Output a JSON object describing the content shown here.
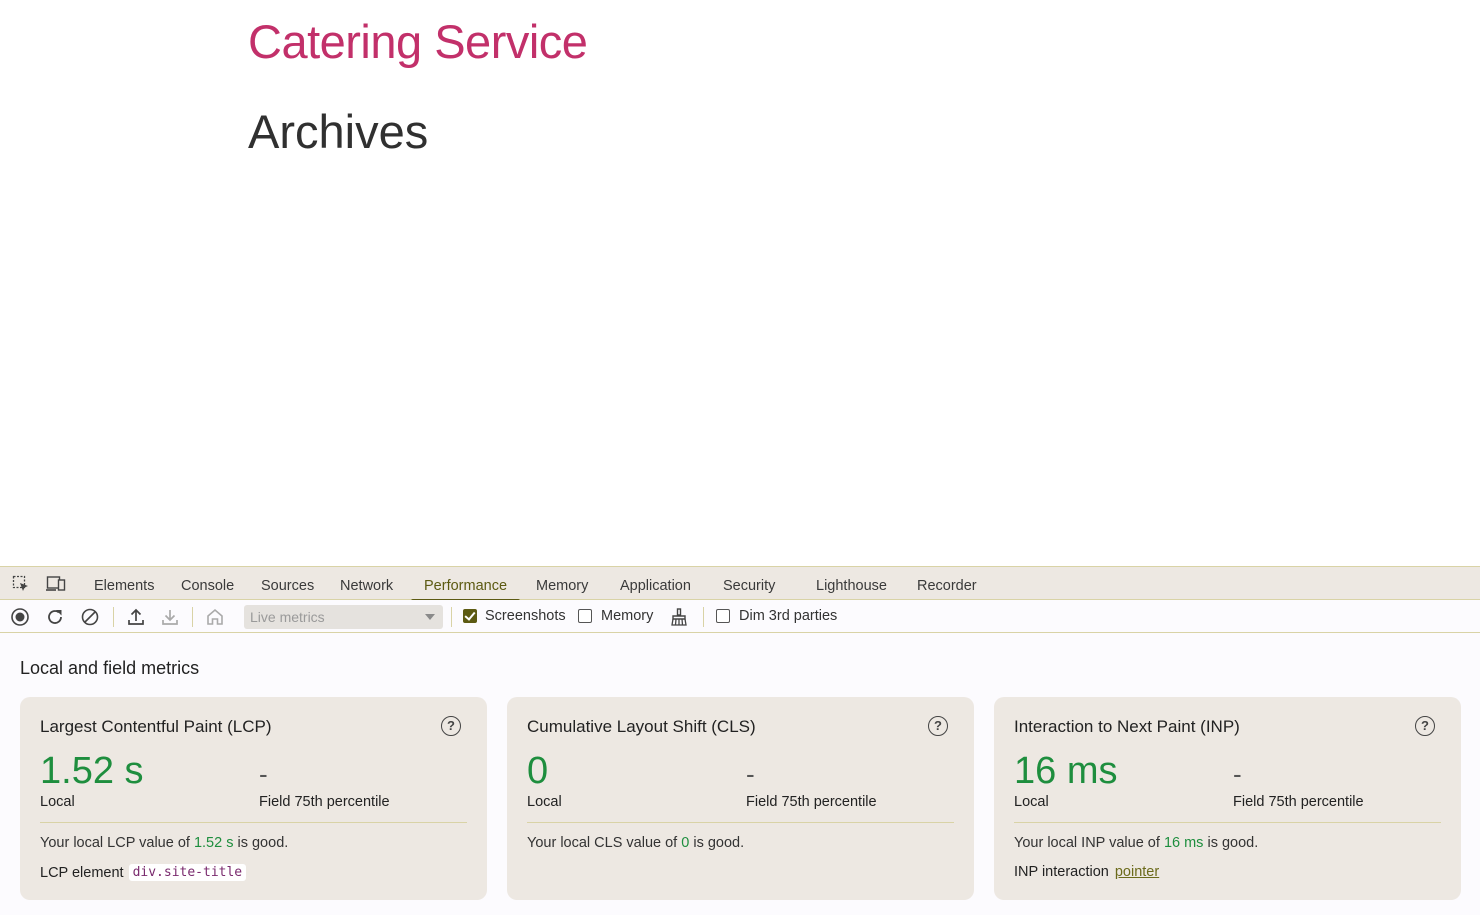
{
  "page": {
    "site_title": "Catering Service",
    "heading": "Archives"
  },
  "devtools": {
    "tabs": [
      "Elements",
      "Console",
      "Sources",
      "Network",
      "Performance",
      "Memory",
      "Application",
      "Security",
      "Lighthouse",
      "Recorder"
    ],
    "active_tab": "Performance",
    "toolbar": {
      "select_value": "Live metrics",
      "screenshots_label": "Screenshots",
      "screenshots_checked": true,
      "memory_label": "Memory",
      "memory_checked": false,
      "dim_label": "Dim 3rd parties",
      "dim_checked": false
    },
    "section_title": "Local and field metrics",
    "colors": {
      "accent": "#5c5a12",
      "good": "#1e8e3e",
      "site_title": "#c2306a"
    },
    "cards": [
      {
        "title": "Largest Contentful Paint (LCP)",
        "value": "1.52 s",
        "field_value": "-",
        "local_label": "Local",
        "field_label": "Field 75th percentile",
        "desc_prefix": "Your local LCP value of ",
        "desc_value": "1.52 s",
        "desc_suffix": " is good.",
        "extra_label": "LCP element",
        "extra_value": "div.site-title"
      },
      {
        "title": "Cumulative Layout Shift (CLS)",
        "value": "0",
        "field_value": "-",
        "local_label": "Local",
        "field_label": "Field 75th percentile",
        "desc_prefix": "Your local CLS value of ",
        "desc_value": "0",
        "desc_suffix": " is good."
      },
      {
        "title": "Interaction to Next Paint (INP)",
        "value": "16 ms",
        "field_value": "-",
        "local_label": "Local",
        "field_label": "Field 75th percentile",
        "desc_prefix": "Your local INP value of ",
        "desc_value": "16 ms",
        "desc_suffix": " is good.",
        "extra_label": "INP interaction",
        "extra_value": "pointer"
      }
    ]
  }
}
